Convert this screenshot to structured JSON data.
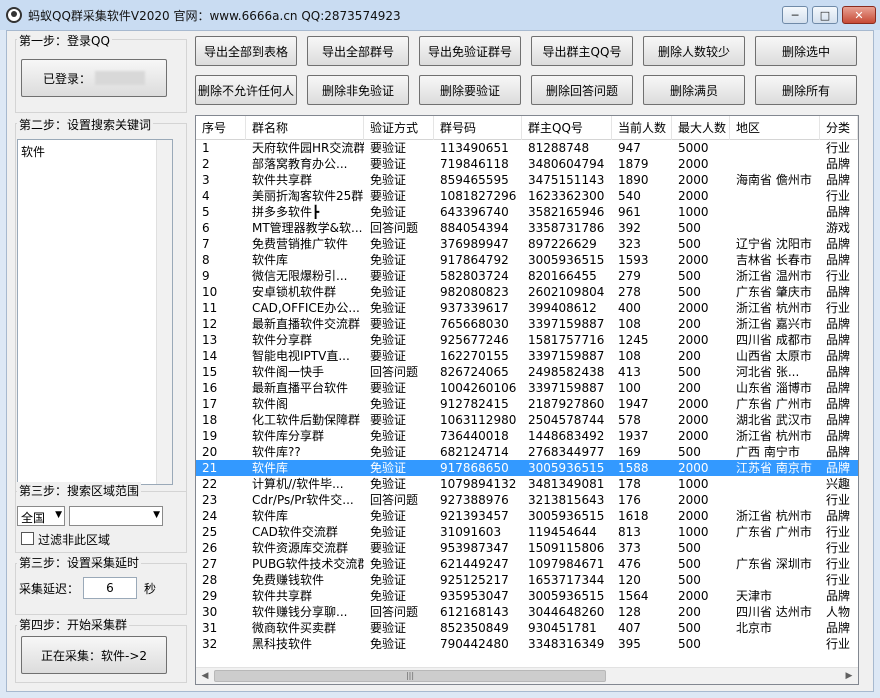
{
  "window": {
    "title": "蚂蚁QQ群采集软件V2020 官网：www.6666a.cn QQ:2873574923",
    "min": "─",
    "max": "□",
    "close": "✕"
  },
  "step1": {
    "label": "第一步：登录QQ",
    "login_button": "已登录："
  },
  "step2": {
    "label": "第二步：设置搜索关键词",
    "keywords": "软件"
  },
  "step3": {
    "label": "第三步：搜索区域范围",
    "region": "全国",
    "region2": "",
    "filter_label": "过滤非此区域"
  },
  "step3b": {
    "label": "第三步：设置采集延时",
    "delay_label": "采集延迟：",
    "delay_value": "6",
    "unit": "秒"
  },
  "step4": {
    "label": "第四步：开始采集群",
    "collect_button": "正在采集：软件->2"
  },
  "toolbar": {
    "row1": [
      "导出全部到表格",
      "导出全部群号",
      "导出免验证群号",
      "导出群主QQ号",
      "删除人数较少",
      "删除选中"
    ],
    "row2": [
      "删除不允许任何人",
      "删除非免验证",
      "删除要验证",
      "删除回答问题",
      "删除满员",
      "删除所有"
    ]
  },
  "table": {
    "columns": [
      "序号",
      "群名称",
      "验证方式",
      "群号码",
      "群主QQ号",
      "当前人数",
      "最大人数",
      "地区",
      "分类"
    ],
    "rows": [
      [
        "1",
        "天府软件园HR交流群",
        "要验证",
        "113490651",
        "81288748",
        "947",
        "5000",
        "",
        "行业"
      ],
      [
        "2",
        "部落窝教育办公...",
        "要验证",
        "719846118",
        "3480604794",
        "1879",
        "2000",
        "",
        "品牌"
      ],
      [
        "3",
        "软件共享群",
        "免验证",
        "859465595",
        "3475151143",
        "1890",
        "2000",
        "海南省 儋州市",
        "品牌"
      ],
      [
        "4",
        "美丽折淘客软件25群",
        "要验证",
        "1081827296",
        "1623362300",
        "540",
        "2000",
        "",
        "行业"
      ],
      [
        "5",
        "拼多多软件┣",
        "免验证",
        "643396740",
        "3582165946",
        "961",
        "1000",
        "",
        "品牌"
      ],
      [
        "6",
        "MT管理器教学&软...",
        "回答问题",
        "884054394",
        "3358731786",
        "392",
        "500",
        "",
        "游戏"
      ],
      [
        "7",
        "免费营销推广软件",
        "免验证",
        "376989947",
        "897226629",
        "323",
        "500",
        "辽宁省 沈阳市",
        "品牌"
      ],
      [
        "8",
        "软件库",
        "免验证",
        "917864792",
        "3005936515",
        "1593",
        "2000",
        "吉林省 长春市",
        "品牌"
      ],
      [
        "9",
        "微信无限爆粉引...",
        "要验证",
        "582803724",
        "820166455",
        "279",
        "500",
        "浙江省 温州市",
        "行业"
      ],
      [
        "10",
        "安卓锁机软件群",
        "免验证",
        "982080823",
        "2602109804",
        "278",
        "500",
        "广东省 肇庆市",
        "品牌"
      ],
      [
        "11",
        "CAD,OFFICE办公...",
        "免验证",
        "937339617",
        "399408612",
        "400",
        "2000",
        "浙江省 杭州市",
        "行业"
      ],
      [
        "12",
        "最新直播软件交流群",
        "要验证",
        "765668030",
        "3397159887",
        "108",
        "200",
        "浙江省 嘉兴市",
        "品牌"
      ],
      [
        "13",
        "软件分享群",
        "免验证",
        "925677246",
        "1581757716",
        "1245",
        "2000",
        "四川省 成都市",
        "品牌"
      ],
      [
        "14",
        "智能电视IPTV直...",
        "要验证",
        "162270155",
        "3397159887",
        "108",
        "200",
        "山西省 太原市",
        "品牌"
      ],
      [
        "15",
        "软件阁一快手",
        "回答问题",
        "826724065",
        "2498582438",
        "413",
        "500",
        "河北省 张...",
        "品牌"
      ],
      [
        "16",
        "最新直播平台软件",
        "要验证",
        "1004260106",
        "3397159887",
        "100",
        "200",
        "山东省 淄博市",
        "品牌"
      ],
      [
        "17",
        "软件阁",
        "免验证",
        "912782415",
        "2187927860",
        "1947",
        "2000",
        "广东省 广州市",
        "品牌"
      ],
      [
        "18",
        "化工软件后勤保障群",
        "要验证",
        "1063112980",
        "2504578744",
        "578",
        "2000",
        "湖北省 武汉市",
        "品牌"
      ],
      [
        "19",
        "软件库分享群",
        "免验证",
        "736440018",
        "1448683492",
        "1937",
        "2000",
        "浙江省 杭州市",
        "品牌"
      ],
      [
        "20",
        "软件库??",
        "免验证",
        "682124714",
        "2768344977",
        "169",
        "500",
        "广西 南宁市",
        "品牌"
      ],
      [
        "21",
        "软件库",
        "免验证",
        "917868650",
        "3005936515",
        "1588",
        "2000",
        "江苏省 南京市",
        "品牌"
      ],
      [
        "22",
        "计算机//软件毕...",
        "免验证",
        "1079894132",
        "3481349081",
        "178",
        "1000",
        "",
        "兴趣"
      ],
      [
        "23",
        "Cdr/Ps/Pr软件交...",
        "回答问题",
        "927388976",
        "3213815643",
        "176",
        "2000",
        "",
        "行业"
      ],
      [
        "24",
        "软件库",
        "免验证",
        "921393457",
        "3005936515",
        "1618",
        "2000",
        "浙江省 杭州市",
        "品牌"
      ],
      [
        "25",
        "CAD软件交流群",
        "免验证",
        "31091603",
        "119454644",
        "813",
        "1000",
        "广东省 广州市",
        "行业"
      ],
      [
        "26",
        "软件资源库交流群",
        "要验证",
        "953987347",
        "1509115806",
        "373",
        "500",
        "",
        "行业"
      ],
      [
        "27",
        "PUBG软件技术交流群",
        "免验证",
        "621449247",
        "1097984671",
        "476",
        "500",
        "广东省 深圳市",
        "行业"
      ],
      [
        "28",
        "免费赚钱软件",
        "免验证",
        "925125217",
        "1653717344",
        "120",
        "500",
        "",
        "行业"
      ],
      [
        "29",
        "软件共享群",
        "免验证",
        "935953047",
        "3005936515",
        "1564",
        "2000",
        "天津市",
        "品牌"
      ],
      [
        "30",
        "软件赚钱分享聊...",
        "回答问题",
        "612168143",
        "3044648260",
        "128",
        "200",
        "四川省 达州市",
        "人物"
      ],
      [
        "31",
        "微商软件买卖群",
        "要验证",
        "852350849",
        "930451781",
        "407",
        "500",
        "北京市",
        "品牌"
      ],
      [
        "32",
        "黑科技软件",
        "免验证",
        "790442480",
        "3348316349",
        "395",
        "500",
        "",
        "行业"
      ]
    ],
    "selected_row": 20
  },
  "scrollbar": {
    "thumb_grip": "|||",
    "left_arrow": "◀",
    "right_arrow": "▶"
  }
}
